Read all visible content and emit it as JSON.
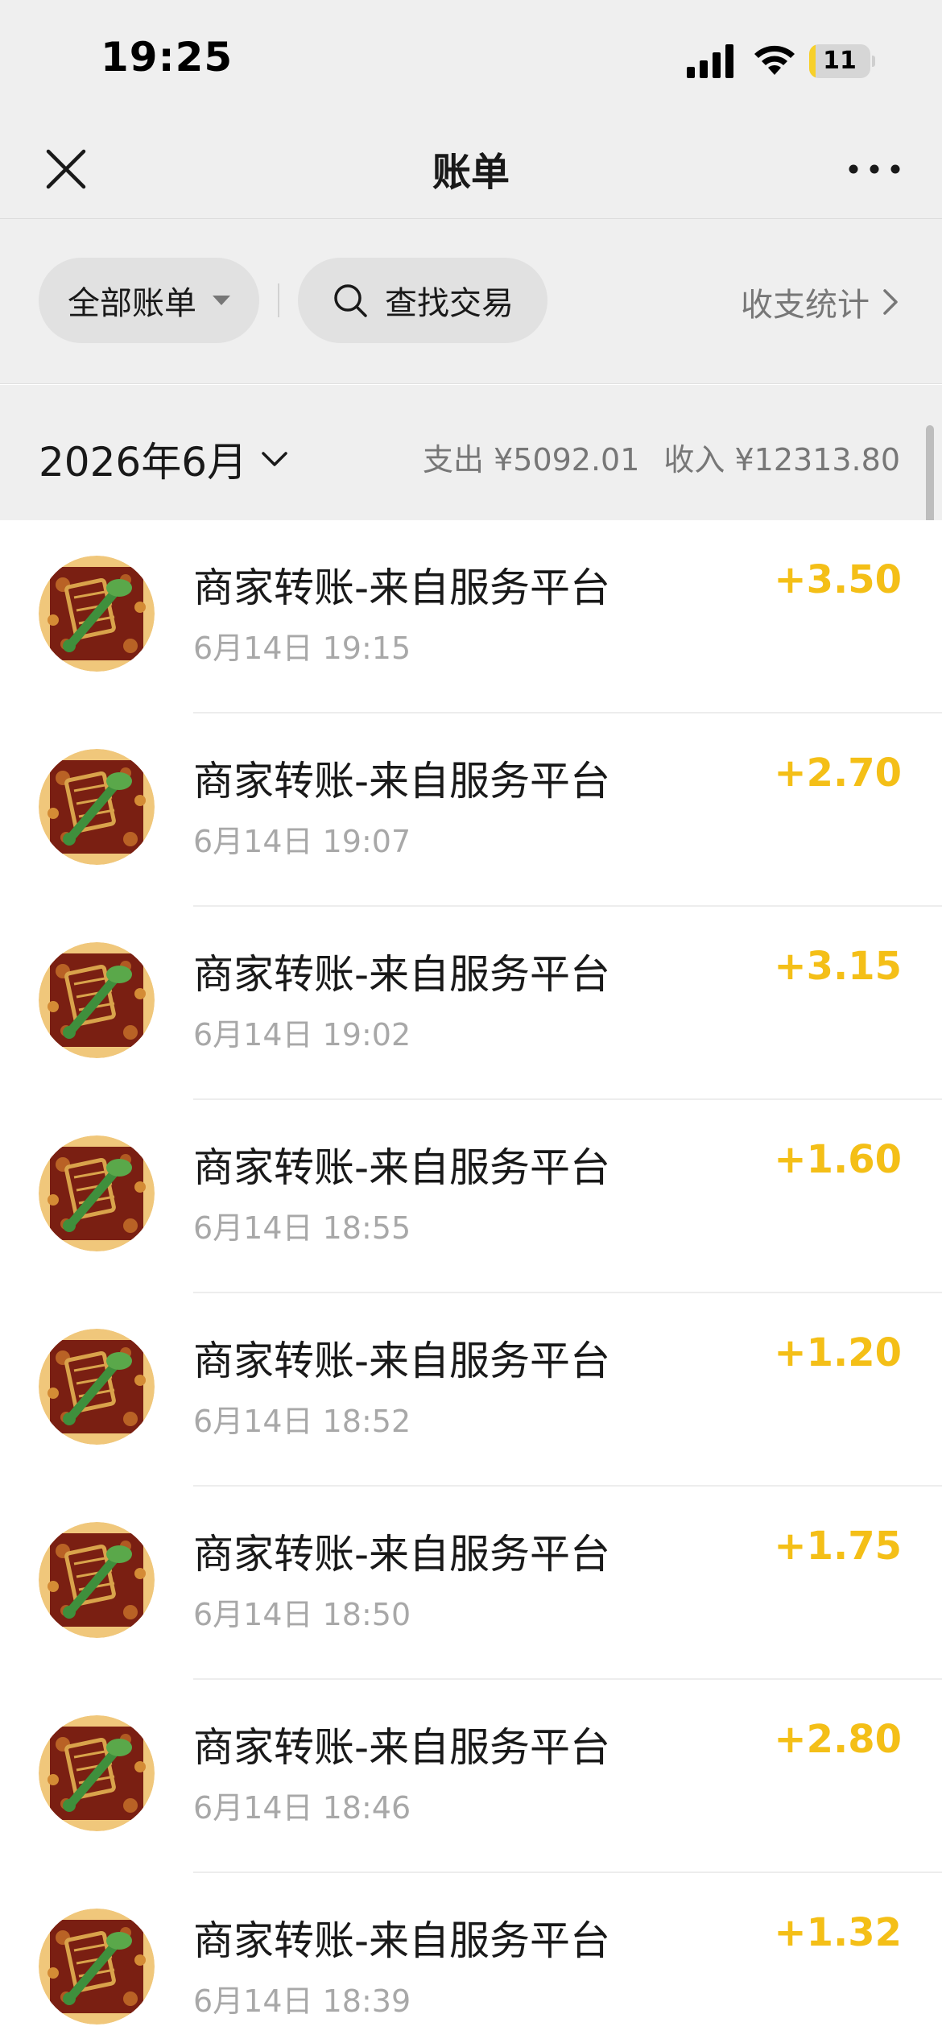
{
  "status_bar": {
    "time": "19:25",
    "battery_level": "11",
    "battery_percent": 11,
    "battery_color": "#f7d02a"
  },
  "nav": {
    "title": "账单",
    "close_icon": "close-icon",
    "more_icon": "more-icon"
  },
  "filters": {
    "all_bills_label": "全部账单",
    "search_label": "查找交易",
    "stats_label": "收支统计"
  },
  "month": {
    "label": "2026年6月",
    "expense": "支出 ¥5092.01",
    "income": "收入 ¥12313.80"
  },
  "colors": {
    "accent": "#f4bf17",
    "background": "#efefef"
  },
  "transactions": [
    {
      "title": "商家转账-来自服务平台",
      "time": "6月14日 19:15",
      "amount": "+3.50"
    },
    {
      "title": "商家转账-来自服务平台",
      "time": "6月14日 19:07",
      "amount": "+2.70"
    },
    {
      "title": "商家转账-来自服务平台",
      "time": "6月14日 19:02",
      "amount": "+3.15"
    },
    {
      "title": "商家转账-来自服务平台",
      "time": "6月14日 18:55",
      "amount": "+1.60"
    },
    {
      "title": "商家转账-来自服务平台",
      "time": "6月14日 18:52",
      "amount": "+1.20"
    },
    {
      "title": "商家转账-来自服务平台",
      "time": "6月14日 18:50",
      "amount": "+1.75"
    },
    {
      "title": "商家转账-来自服务平台",
      "time": "6月14日 18:46",
      "amount": "+2.80"
    },
    {
      "title": "商家转账-来自服务平台",
      "time": "6月14日 18:39",
      "amount": "+1.32"
    }
  ]
}
